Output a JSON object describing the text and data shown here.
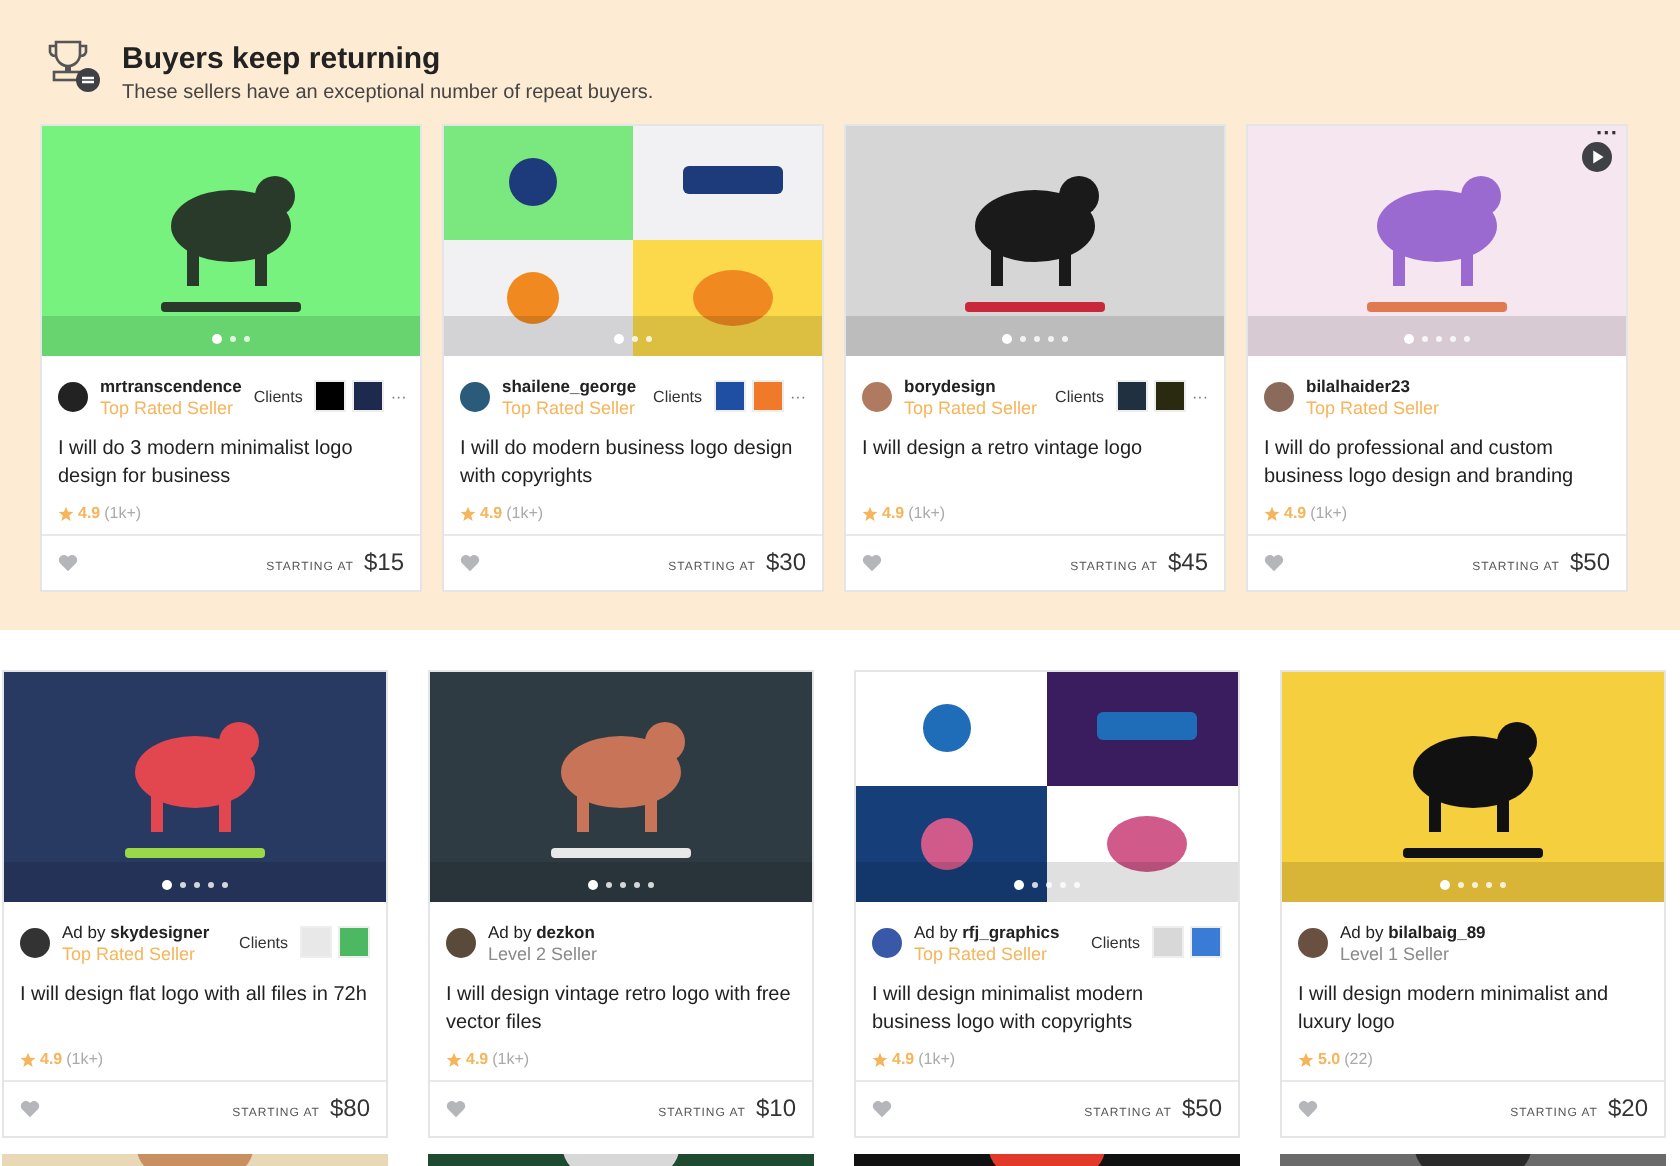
{
  "section": {
    "title": "Buyers keep returning",
    "subtitle": "These sellers have an exceptional number of repeat buyers.",
    "cards": [
      {
        "seller": "mrtranscendence",
        "level": {
          "text": "Top Rated Seller",
          "kind": "top"
        },
        "clients": {
          "label": "Clients",
          "logos": [
            {
              "color": "#000000"
            },
            {
              "color": "#1d2a4d"
            }
          ],
          "more": "···"
        },
        "title": "I will do 3 modern minimalist logo design for business",
        "rating": "4.9",
        "reviews": "(1k+)",
        "favorited": false,
        "price_label": "STARTING AT",
        "price": "$15",
        "dots": [
          {
            "selected": true
          },
          {
            "selected": false
          },
          {
            "selected": false
          }
        ]
      },
      {
        "seller": "shailene_george",
        "level": {
          "text": "Top Rated Seller",
          "kind": "top"
        },
        "clients": {
          "label": "Clients",
          "logos": [
            {
              "color": "#1f4fa3"
            },
            {
              "color": "#f07a2a"
            }
          ],
          "more": "···"
        },
        "title": "I will do modern business logo design with copyrights",
        "rating": "4.9",
        "reviews": "(1k+)",
        "favorited": false,
        "price_label": "STARTING AT",
        "price": "$30",
        "dots": [
          {
            "selected": true
          },
          {
            "selected": false
          },
          {
            "selected": false
          }
        ]
      },
      {
        "seller": "borydesign",
        "level": {
          "text": "Top Rated Seller",
          "kind": "top"
        },
        "clients": {
          "label": "Clients",
          "logos": [
            {
              "color": "#203040"
            },
            {
              "color": "#2a2a10"
            }
          ],
          "more": "···"
        },
        "title": "I will design a retro vintage logo",
        "rating": "4.9",
        "reviews": "(1k+)",
        "favorited": false,
        "price_label": "STARTING AT",
        "price": "$45",
        "dots": [
          {
            "selected": true
          },
          {
            "selected": false
          },
          {
            "selected": false
          },
          {
            "selected": false
          },
          {
            "selected": false
          }
        ]
      },
      {
        "seller": "bilalhaider23",
        "level": {
          "text": "Top Rated Seller",
          "kind": "top"
        },
        "title": "I will do professional and custom business logo design and branding",
        "rating": "4.9",
        "reviews": "(1k+)",
        "favorited": false,
        "price_label": "STARTING AT",
        "price": "$50",
        "video": true,
        "image_menu": "···",
        "dots": [
          {
            "selected": true
          },
          {
            "selected": false
          },
          {
            "selected": false
          },
          {
            "selected": false
          },
          {
            "selected": false
          }
        ]
      }
    ]
  },
  "gigs": [
    {
      "ad_prefix": "Ad by",
      "seller": "skydesigner",
      "level": {
        "text": "Top Rated Seller",
        "kind": "top"
      },
      "clients": {
        "label": "Clients",
        "logos": [
          {
            "color": "#e8e8e8"
          },
          {
            "color": "#4cb962"
          }
        ]
      },
      "title": "I will design flat logo with all files in 72h",
      "rating": "4.9",
      "reviews": "(1k+)",
      "favorited": false,
      "price_label": "STARTING AT",
      "price": "$80",
      "dots": [
        {
          "selected": true
        },
        {
          "selected": false
        },
        {
          "selected": false
        },
        {
          "selected": false
        },
        {
          "selected": false
        }
      ]
    },
    {
      "ad_prefix": "Ad by",
      "seller": "dezkon",
      "level": {
        "text": "Level 2 Seller",
        "kind": "level"
      },
      "title": "I will design vintage retro logo with free vector files",
      "rating": "4.9",
      "reviews": "(1k+)",
      "favorited": false,
      "price_label": "STARTING AT",
      "price": "$10",
      "dots": [
        {
          "selected": true
        },
        {
          "selected": false
        },
        {
          "selected": false
        },
        {
          "selected": false
        },
        {
          "selected": false
        }
      ]
    },
    {
      "ad_prefix": "Ad by",
      "seller": "rfj_graphics",
      "level": {
        "text": "Top Rated Seller",
        "kind": "top"
      },
      "clients": {
        "label": "Clients",
        "logos": [
          {
            "color": "#d8d8d8"
          },
          {
            "color": "#3a7bd5"
          }
        ]
      },
      "title": "I will design minimalist modern business logo with copyrights",
      "rating": "4.9",
      "reviews": "(1k+)",
      "favorited": false,
      "price_label": "STARTING AT",
      "price": "$50",
      "dots": [
        {
          "selected": true
        },
        {
          "selected": false
        },
        {
          "selected": false
        },
        {
          "selected": false
        },
        {
          "selected": false
        }
      ]
    },
    {
      "ad_prefix": "Ad by",
      "seller": "bilalbaig_89",
      "level": {
        "text": "Level 1 Seller",
        "kind": "level"
      },
      "title": "I will design modern minimalist and luxury logo",
      "rating": "5.0",
      "reviews": "(22)",
      "favorited": false,
      "price_label": "STARTING AT",
      "price": "$20",
      "dots": [
        {
          "selected": true
        },
        {
          "selected": false
        },
        {
          "selected": false
        },
        {
          "selected": false
        },
        {
          "selected": false
        }
      ]
    }
  ]
}
